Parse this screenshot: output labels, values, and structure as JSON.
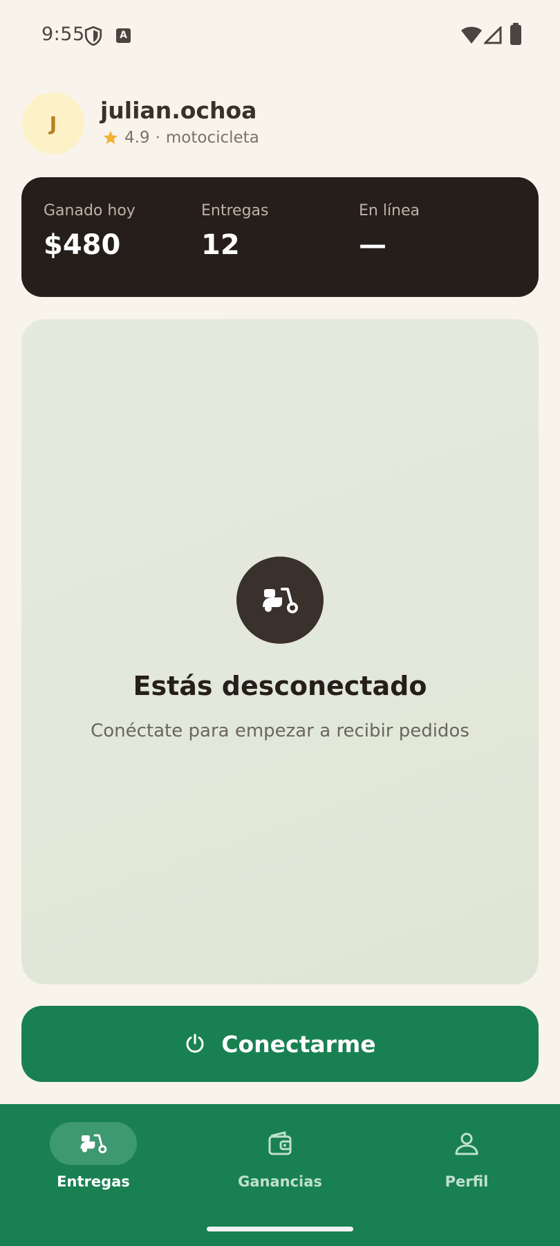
{
  "status_bar": {
    "time": "9:55"
  },
  "user": {
    "avatar_initial": "J",
    "name": "julian.ochoa",
    "rating": "4.9",
    "separator": "·",
    "vehicle": "motocicleta"
  },
  "stats": [
    {
      "label": "Ganado hoy",
      "value": "$480"
    },
    {
      "label": "Entregas",
      "value": "12"
    },
    {
      "label": "En línea",
      "value": "—"
    }
  ],
  "status_panel": {
    "icon": "scooter-icon",
    "title": "Estás desconectado",
    "subtitle": "Conéctate para empezar a recibir pedidos"
  },
  "connect_button": {
    "icon": "power-icon",
    "label": "Conectarme"
  },
  "nav": [
    {
      "label": "Entregas",
      "icon": "scooter-icon",
      "active": true
    },
    {
      "label": "Ganancias",
      "icon": "wallet-icon",
      "active": false
    },
    {
      "label": "Perfil",
      "icon": "person-icon",
      "active": false
    }
  ],
  "colors": {
    "background": "#f8f4ec",
    "stats_card": "#261e1a",
    "primary_green": "#198052",
    "avatar_bg": "#fdf1c8",
    "star": "#f2b233"
  }
}
